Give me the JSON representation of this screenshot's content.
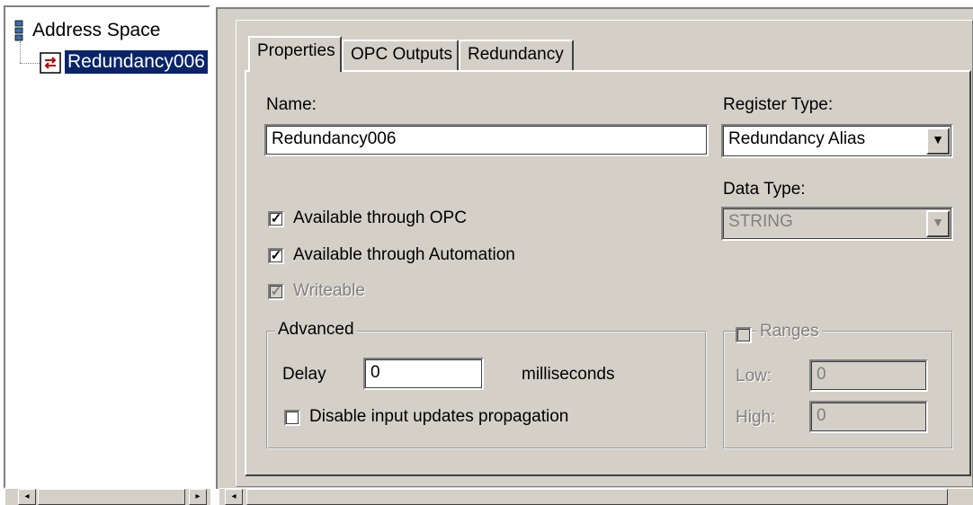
{
  "tree": {
    "root_label": "Address Space",
    "child_label": "Redundancy006"
  },
  "tabs": [
    {
      "label": "Properties"
    },
    {
      "label": "OPC Outputs"
    },
    {
      "label": "Redundancy"
    }
  ],
  "properties": {
    "name_label": "Name:",
    "name_value": "Redundancy006",
    "register_type_label": "Register Type:",
    "register_type_value": "Redundancy Alias",
    "data_type_label": "Data Type:",
    "data_type_value": "STRING",
    "checkboxes": {
      "opc": {
        "label": "Available through OPC",
        "checked": true
      },
      "automation": {
        "label": "Available through Automation",
        "checked": true
      },
      "writeable": {
        "label": "Writeable",
        "checked": true,
        "disabled": true
      }
    },
    "advanced": {
      "title": "Advanced",
      "delay_label": "Delay",
      "delay_value": "0",
      "delay_unit": "milliseconds",
      "disable_propagation_label": "Disable input updates propagation",
      "disable_propagation_checked": false
    },
    "ranges": {
      "title": "Ranges",
      "checked": false,
      "low_label": "Low:",
      "low_value": "0",
      "high_label": "High:",
      "high_value": "0"
    }
  }
}
